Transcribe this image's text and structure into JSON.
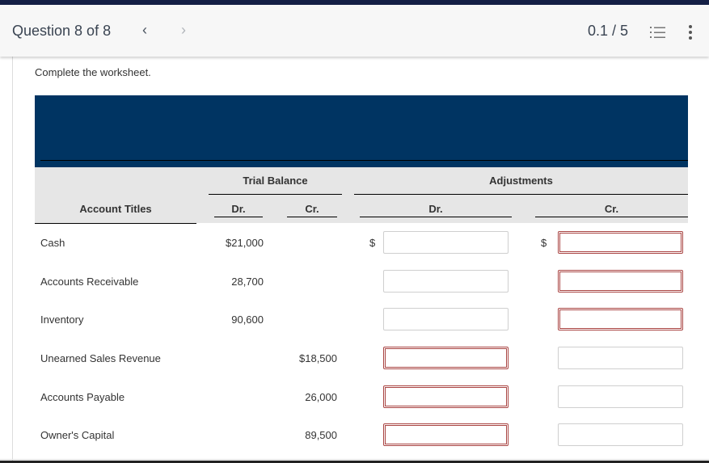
{
  "header": {
    "question_label": "Question 8 of 8",
    "prev_icon": "chevron-left-icon",
    "next_icon": "chevron-right-icon",
    "score": "0.1 / 5",
    "list_icon": "numbered-list-icon",
    "more_icon": "more-vertical-icon"
  },
  "prompt": "Complete the worksheet.",
  "worksheet": {
    "account_titles_header": "Account Titles",
    "groups": [
      {
        "label": "Trial Balance",
        "dr": "Dr.",
        "cr": "Cr."
      },
      {
        "label": "Adjustments",
        "dr": "Dr.",
        "cr": "Cr."
      }
    ],
    "currency_symbol": "$",
    "rows": [
      {
        "account": "Cash",
        "tb_dr": "$21,000",
        "tb_cr": "",
        "adj_dr": "",
        "adj_cr": "",
        "adj_dr_error": false,
        "adj_cr_error": true
      },
      {
        "account": "Accounts Receivable",
        "tb_dr": "28,700",
        "tb_cr": "",
        "adj_dr": "",
        "adj_cr": "",
        "adj_dr_error": false,
        "adj_cr_error": true
      },
      {
        "account": "Inventory",
        "tb_dr": "90,600",
        "tb_cr": "",
        "adj_dr": "",
        "adj_cr": "",
        "adj_dr_error": false,
        "adj_cr_error": true
      },
      {
        "account": "Unearned Sales Revenue",
        "tb_dr": "",
        "tb_cr": "$18,500",
        "adj_dr": "",
        "adj_cr": "",
        "adj_dr_error": true,
        "adj_cr_error": false
      },
      {
        "account": "Accounts Payable",
        "tb_dr": "",
        "tb_cr": "26,000",
        "adj_dr": "",
        "adj_cr": "",
        "adj_dr_error": true,
        "adj_cr_error": false
      },
      {
        "account": "Owner's Capital",
        "tb_dr": "",
        "tb_cr": "89,500",
        "adj_dr": "",
        "adj_cr": "",
        "adj_dr_error": true,
        "adj_cr_error": false
      }
    ]
  },
  "colors": {
    "banner": "#003462",
    "top_bar": "#141f45",
    "error_border": "#a94442",
    "header_row_bg": "#e6e6e6"
  }
}
